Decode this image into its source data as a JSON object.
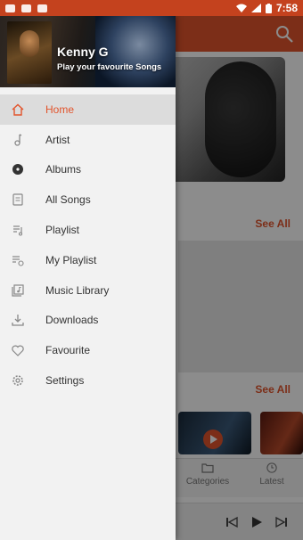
{
  "status_bar": {
    "time": "7:58"
  },
  "background_screen": {
    "see_all_1": "See All",
    "see_all_2": "See All",
    "nav_categories": "Categories",
    "nav_latest": "Latest"
  },
  "drawer": {
    "header": {
      "title": "Kenny G",
      "subtitle": "Play your favourite Songs"
    },
    "menu": [
      {
        "label": "Home",
        "icon": "home-icon",
        "active": true
      },
      {
        "label": "Artist",
        "icon": "artist-icon",
        "active": false
      },
      {
        "label": "Albums",
        "icon": "albums-icon",
        "active": false
      },
      {
        "label": "All Songs",
        "icon": "all-songs-icon",
        "active": false
      },
      {
        "label": "Playlist",
        "icon": "playlist-icon",
        "active": false
      },
      {
        "label": "My Playlist",
        "icon": "my-playlist-icon",
        "active": false
      },
      {
        "label": "Music Library",
        "icon": "music-library-icon",
        "active": false
      },
      {
        "label": "Downloads",
        "icon": "downloads-icon",
        "active": false
      },
      {
        "label": "Favourite",
        "icon": "heart-icon",
        "active": false
      },
      {
        "label": "Settings",
        "icon": "gear-icon",
        "active": false
      }
    ]
  },
  "colors": {
    "accent": "#e2542c",
    "status_bar": "#c4421e",
    "drawer_bg": "#f2f2f2",
    "active_item_bg": "#dcdcdc"
  }
}
